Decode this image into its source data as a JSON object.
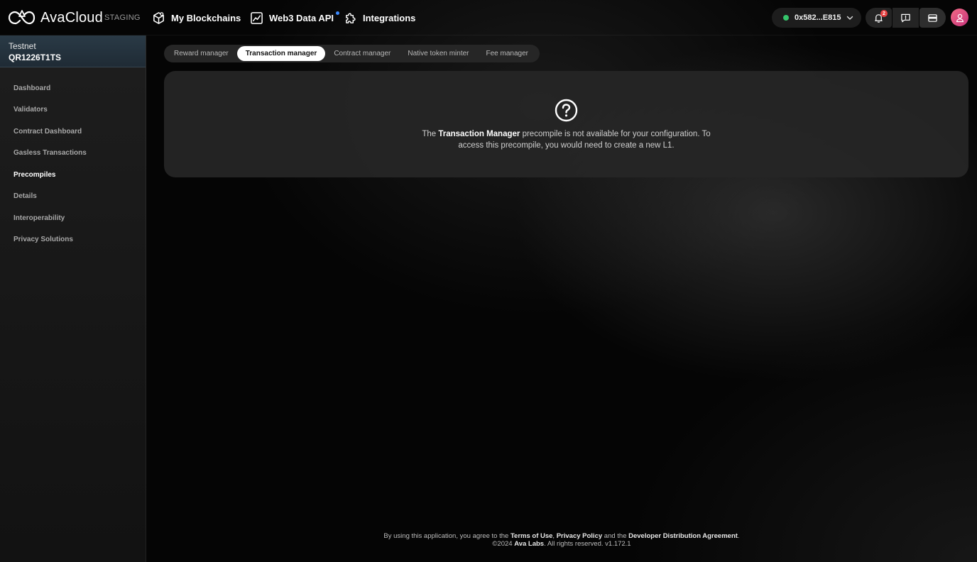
{
  "app": {
    "name": "AvaCloud",
    "environment": "STAGING"
  },
  "topnav": {
    "items": [
      {
        "label": "My Blockchains",
        "icon": "blockchain-cube-icon"
      },
      {
        "label": "Web3 Data API",
        "icon": "chart-trend-icon",
        "has_new_dot": true
      },
      {
        "label": "Integrations",
        "icon": "puzzle-icon"
      }
    ],
    "wallet": {
      "address": "0x582...E815",
      "status_color": "#35c46b"
    },
    "notifications_count": "2",
    "icons": [
      "bell-icon",
      "feedback-icon",
      "wallet-card-icon",
      "user-avatar-icon"
    ]
  },
  "sidebar": {
    "network": "Testnet",
    "project_name": "QR1226T1TS",
    "items": [
      {
        "label": "Dashboard"
      },
      {
        "label": "Validators"
      },
      {
        "label": "Contract Dashboard"
      },
      {
        "label": "Gasless Transactions"
      },
      {
        "label": "Precompiles",
        "active": true
      },
      {
        "label": "Details"
      },
      {
        "label": "Interoperability"
      },
      {
        "label": "Privacy Solutions"
      }
    ]
  },
  "tabs": [
    {
      "label": "Reward manager"
    },
    {
      "label": "Transaction manager",
      "active": true
    },
    {
      "label": "Contract manager"
    },
    {
      "label": "Native token minter"
    },
    {
      "label": "Fee manager"
    }
  ],
  "card": {
    "icon": "question-circle-icon",
    "msg_prefix": "The ",
    "msg_bold": "Transaction Manager",
    "msg_line1_rest": " precompile is not available for your configuration. To",
    "msg_line2": "access this precompile, you would need to create a new L1."
  },
  "footer": {
    "text1": "By using this application, you agree to the ",
    "link_terms": "Terms of Use",
    "sep1": ", ",
    "link_privacy": "Privacy Policy",
    "text2": " and the ",
    "link_dda": "Developer Distribution Agreement",
    "text3": ".",
    "copyright": "©2024 ",
    "company": "Ava Labs",
    "rights": ".  All rights reserved.  ",
    "version": "v1.172.1"
  },
  "colors": {
    "accent_blue": "#3d8bff",
    "badge_red": "#e84142",
    "status_green": "#35c46b"
  }
}
